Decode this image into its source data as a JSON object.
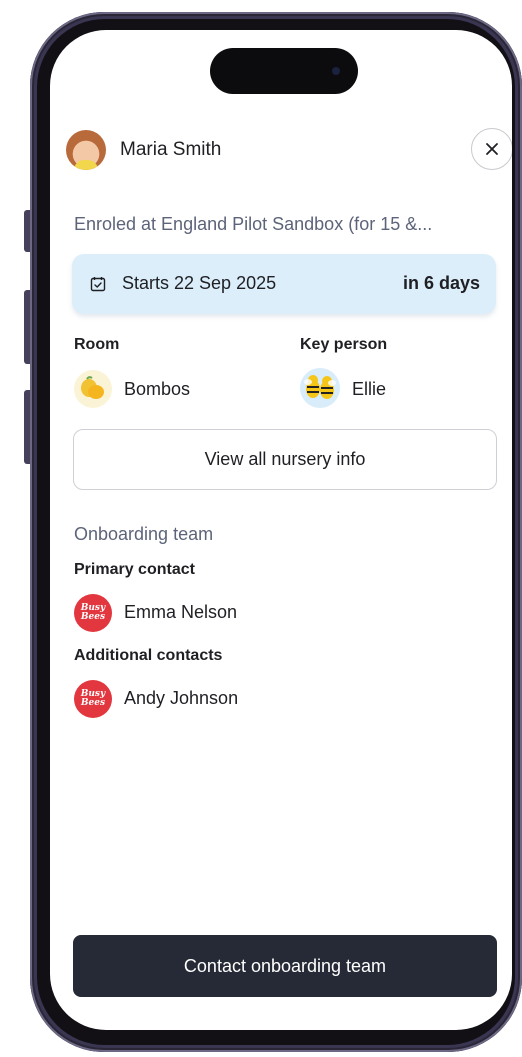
{
  "child": {
    "name": "Maria Smith"
  },
  "enrolment": {
    "text": "Enroled at England Pilot Sandbox (for 15 &..."
  },
  "start": {
    "label": "Starts 22 Sep 2025",
    "countdown": "in 6 days"
  },
  "room": {
    "heading": "Room",
    "name": "Bombos"
  },
  "key_person": {
    "heading": "Key person",
    "name": "Ellie"
  },
  "actions": {
    "view_nursery_info": "View all nursery info",
    "contact_team": "Contact onboarding team"
  },
  "onboarding": {
    "section_title": "Onboarding team",
    "primary_heading": "Primary contact",
    "primary_contact": "Emma Nelson",
    "additional_heading": "Additional contacts",
    "additional_contacts": [
      "Andy Johnson"
    ],
    "logo_line1": "Busy",
    "logo_line2": "Bees"
  },
  "icons": {
    "close": "close-icon",
    "calendar": "calendar-check-icon",
    "room": "lemon-icon",
    "key_person": "bees-icon",
    "contact_logo": "busy-bees-logo"
  },
  "colors": {
    "start_banner": "#dbeefa",
    "primary_button": "#262936",
    "secondary_text": "#5d647a",
    "logo_red": "#e2373e"
  }
}
